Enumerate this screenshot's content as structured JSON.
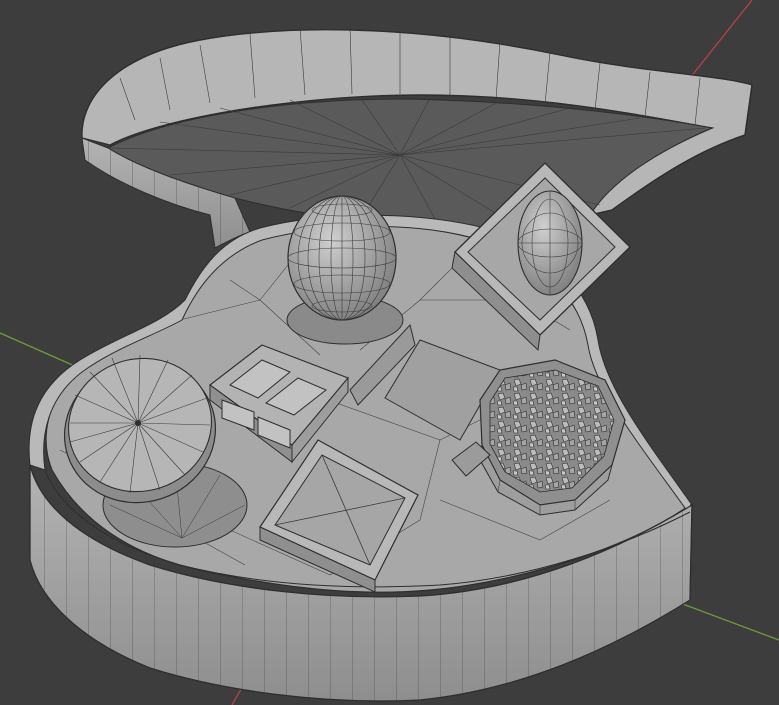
{
  "viewport": {
    "background": "#3d3d3d",
    "x_axis_color": "#b8404a",
    "y_axis_color": "#6e9a3c",
    "mesh_fill": "#a9a9a9",
    "mesh_shadow": "#6f6f6f",
    "mesh_dark": "#565656",
    "wire_color": "#2e2e2e"
  },
  "scene": {
    "objects": [
      "box-lid",
      "box-base",
      "sphere-chocolate",
      "disc-chocolate",
      "square-grid-chocolate",
      "pyramid-chocolate",
      "diamond-tile-chocolate",
      "crystal-bowl-chocolate"
    ]
  }
}
